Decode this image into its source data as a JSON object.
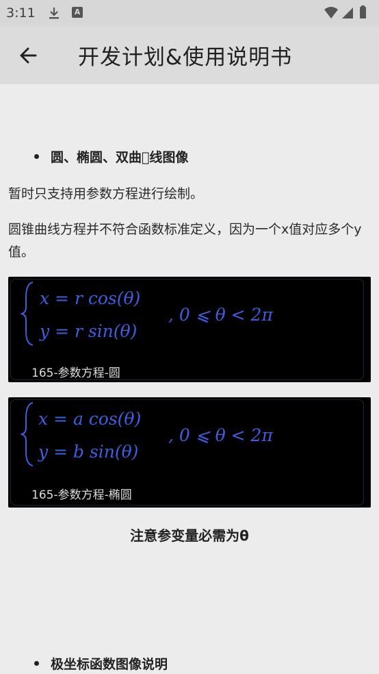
{
  "status_bar": {
    "time": "3:11",
    "app_icon_letter": "A"
  },
  "app_bar": {
    "title": "开发计划&使用说明书"
  },
  "content": {
    "section1_title": "圆、椭圆、双曲\u0000线图像",
    "para1": "暂时只支持用参数方程进行绘制。",
    "para2": "圆锥曲线方程并不符合函数标准定义，因为一个x值对应多个y值。",
    "image1": {
      "caption": "165-参数方程-圆",
      "line1": "x = r cos(θ)",
      "line2": "y = r sin(θ)",
      "range": ",   0 ⩽ θ < 2π"
    },
    "image2": {
      "caption": "165-参数方程-椭圆",
      "line1": "x = a cos(θ)",
      "line2": "y = b sin(θ)",
      "range": ",   0 ⩽ θ < 2π"
    },
    "note": "注意参变量必需为θ",
    "section2_title": "极坐标函数图像说明"
  },
  "colors": {
    "formula_blue": "#3d5fe0",
    "background": "#ececec",
    "app_bar": "#dcdcdc"
  }
}
